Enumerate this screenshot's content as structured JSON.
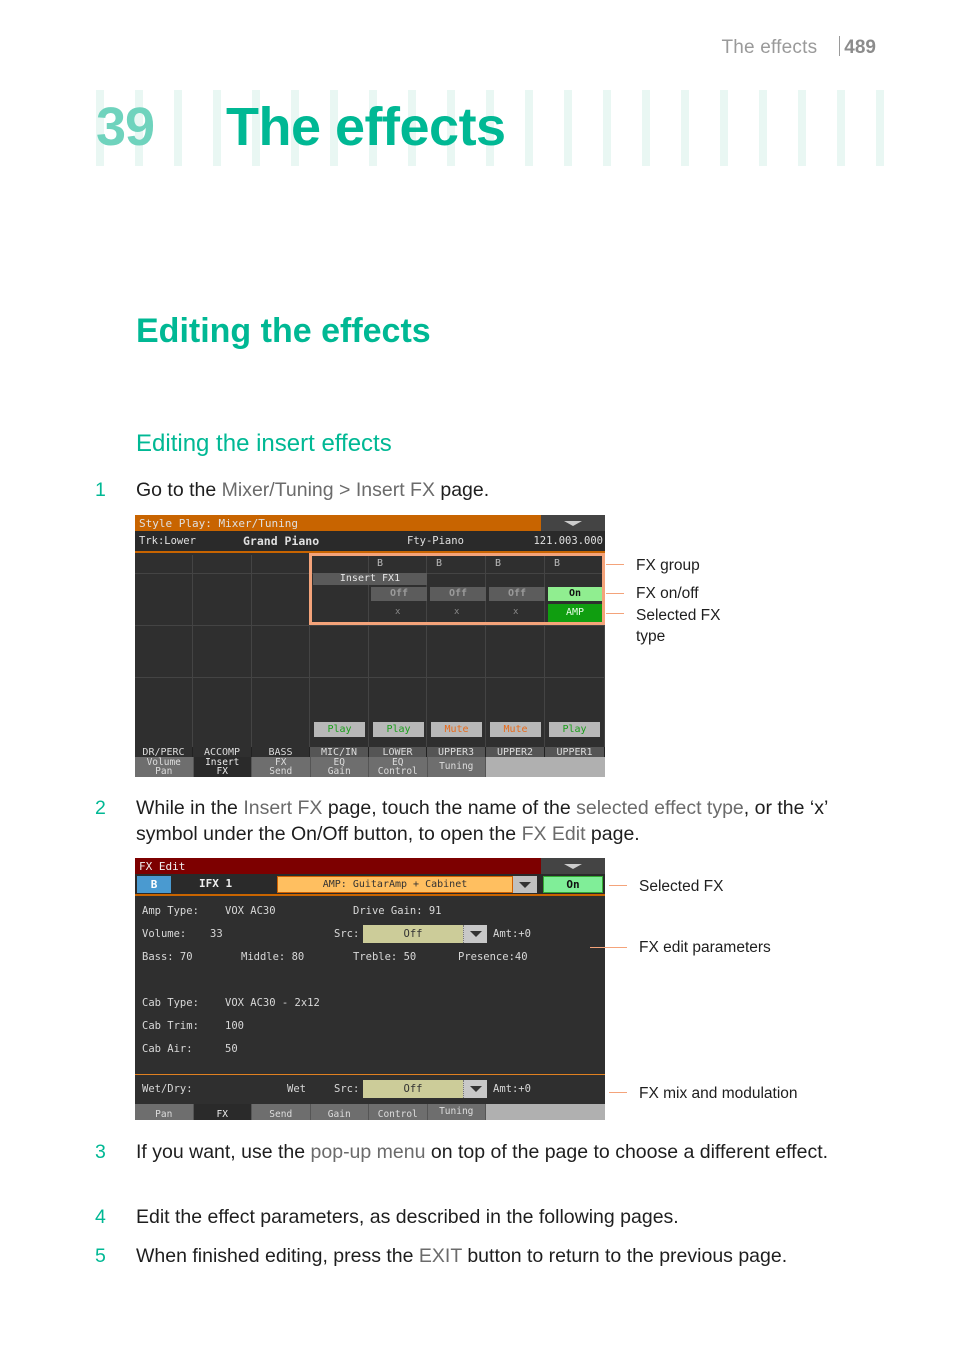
{
  "running_head": {
    "section": "The effects",
    "page": "489"
  },
  "chapter": {
    "number": "39",
    "title": "The effects"
  },
  "heading1": "Editing the effects",
  "heading2": "Editing the insert effects",
  "colors": {
    "accent": "#00b894",
    "callout": "#f4a37a",
    "highlight_text": "#6b6b6b"
  },
  "steps": [
    {
      "n": "1",
      "parts": [
        {
          "t": "Go to the ",
          "hl": false
        },
        {
          "t": "Mixer/Tuning > Insert FX",
          "hl": true
        },
        {
          "t": " page.",
          "hl": false
        }
      ]
    },
    {
      "n": "2",
      "parts": [
        {
          "t": "While in the ",
          "hl": false
        },
        {
          "t": "Insert FX",
          "hl": true
        },
        {
          "t": " page, touch the name of the ",
          "hl": false
        },
        {
          "t": "selected effect type",
          "hl": true
        },
        {
          "t": ", or the ‘x’ symbol under the On/Off button, to open the ",
          "hl": false
        },
        {
          "t": "FX Edit",
          "hl": true
        },
        {
          "t": " page.",
          "hl": false
        }
      ]
    },
    {
      "n": "3",
      "parts": [
        {
          "t": "If you want, use the ",
          "hl": false
        },
        {
          "t": "pop-up menu",
          "hl": true
        },
        {
          "t": " on top of the page to choose a different effect.",
          "hl": false
        }
      ]
    },
    {
      "n": "4",
      "parts": [
        {
          "t": "Edit the effect parameters, as described in the following pages.",
          "hl": false
        }
      ]
    },
    {
      "n": "5",
      "parts": [
        {
          "t": "When finished editing, press the ",
          "hl": false
        },
        {
          "t": "EXIT",
          "hl": true
        },
        {
          "t": " button to return to the previous page.",
          "hl": false
        }
      ]
    }
  ],
  "screen1": {
    "title": "Style Play: Mixer/Tuning",
    "track_label": "Trk:Lower",
    "sound_name": "Grand Piano",
    "category": "Fty-Piano",
    "bank_number": "121.003.000",
    "fx_group_labels": [
      "B",
      "B",
      "B",
      "B"
    ],
    "insert_fx_label": "Insert FX1",
    "onoff": [
      "Off",
      "Off",
      "Off",
      "On"
    ],
    "fx_types": [
      "x",
      "x",
      "x",
      "AMP"
    ],
    "play_states": [
      {
        "label": "Play",
        "state": "play"
      },
      {
        "label": "Play",
        "state": "play"
      },
      {
        "label": "Mute",
        "state": "mute"
      },
      {
        "label": "Mute",
        "state": "mute"
      },
      {
        "label": "Play",
        "state": "play"
      }
    ],
    "channels": [
      "DR/PERC",
      "ACCOMP",
      "BASS",
      "MIC/IN",
      "LOWER",
      "UPPER3",
      "UPPER2",
      "UPPER1"
    ],
    "tabs": [
      {
        "l1": "Volume",
        "l2": "Pan",
        "selected": false
      },
      {
        "l1": "Insert",
        "l2": "FX",
        "selected": true
      },
      {
        "l1": "FX",
        "l2": "Send",
        "selected": false
      },
      {
        "l1": "EQ",
        "l2": "Gain",
        "selected": false
      },
      {
        "l1": "EQ",
        "l2": "Control",
        "selected": false
      },
      {
        "l1": "Tuning",
        "l2": "",
        "selected": false
      }
    ],
    "callouts": [
      "FX group",
      "FX on/off",
      "Selected FX type"
    ]
  },
  "screen2": {
    "title": "FX Edit",
    "group": "B",
    "ifx": "IFX 1",
    "fx_type": "AMP: GuitarAmp + Cabinet",
    "on_label": "On",
    "params": {
      "amp_type_label": "Amp Type:",
      "amp_type": "VOX AC30",
      "drive_gain": "Drive Gain: 91",
      "volume_label": "Volume:",
      "volume": "33",
      "src_label": "Src:",
      "src_value": "Off",
      "amt": "Amt:+0",
      "bass": "Bass: 70",
      "middle": "Middle: 80",
      "treble": "Treble: 50",
      "presence": "Presence:40",
      "cab_type_label": "Cab Type:",
      "cab_type": "VOX AC30 - 2x12",
      "cab_trim_label": "Cab Trim:",
      "cab_trim": "100",
      "cab_air_label": "Cab Air:",
      "cab_air": "50"
    },
    "mix": {
      "wetdry_label": "Wet/Dry:",
      "wetdry": "Wet",
      "src_label": "Src:",
      "src_value": "Off",
      "amt": "Amt:+0"
    },
    "callouts": [
      "Selected FX",
      "FX edit parameters",
      "FX mix and modulation"
    ]
  }
}
